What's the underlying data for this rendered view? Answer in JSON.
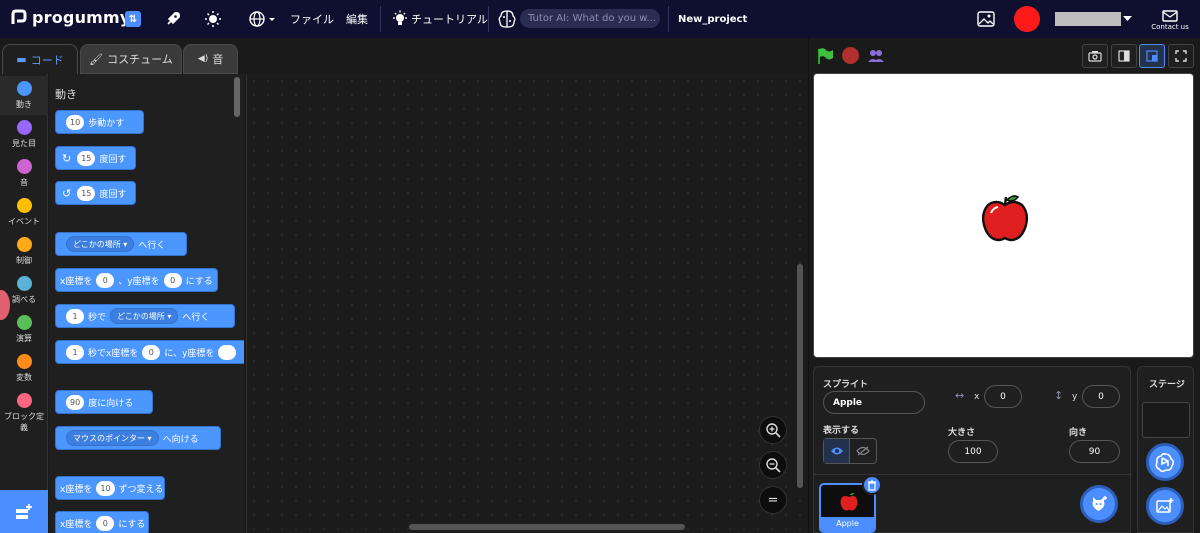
{
  "menubar": {
    "logo_text": "progummy",
    "file_label": "ファイル",
    "edit_label": "編集",
    "tutorial_label": "チュートリアル",
    "tutor_placeholder": "Tutor AI: What do you w...",
    "project_title": "New_project",
    "contact_label": "Contact us",
    "username_masked": ""
  },
  "tabs": {
    "code": "コード",
    "costume": "コスチューム",
    "sound": "音"
  },
  "categories": [
    {
      "label": "動き",
      "color": "#4c97ff"
    },
    {
      "label": "見た目",
      "color": "#9966ff"
    },
    {
      "label": "音",
      "color": "#cf63cf"
    },
    {
      "label": "イベント",
      "color": "#ffbf00"
    },
    {
      "label": "制御",
      "color": "#ffab19"
    },
    {
      "label": "調べる",
      "color": "#5cb1d6"
    },
    {
      "label": "演算",
      "color": "#59c059"
    },
    {
      "label": "変数",
      "color": "#ff8c1a"
    },
    {
      "label": "ブロック定",
      "label2": "義",
      "color": "#ff6680"
    }
  ],
  "palette": {
    "title": "動き",
    "move_steps": {
      "value": "10",
      "text": "歩動かす"
    },
    "turn_right": {
      "value": "15",
      "text": "度回す"
    },
    "turn_left": {
      "value": "15",
      "text": "度回す"
    },
    "goto": {
      "dropdown": "どこかの場所",
      "text": "へ行く"
    },
    "goto_xy": {
      "x_prefix": "x座標を",
      "x": "0",
      "y_prefix": "、y座標を",
      "y": "0",
      "suffix": "にする"
    },
    "glide_to": {
      "secs": "1",
      "mid": "秒で",
      "dropdown": "どこかの場所",
      "text": "へ行く"
    },
    "glide_xy": {
      "secs": "1",
      "mid": "秒でx座標を",
      "x": "0",
      "y_prefix": "に、y座標を"
    },
    "point_dir": {
      "value": "90",
      "text": "度に向ける"
    },
    "point_towards": {
      "dropdown": "マウスのポインター",
      "text": "へ向ける"
    },
    "change_x": {
      "prefix": "x座標を",
      "value": "10",
      "text": "ずつ変える"
    },
    "set_x": {
      "prefix": "x座標を",
      "value": "0",
      "text": "にする"
    }
  },
  "zoom": {
    "reset_label": "="
  },
  "sprite_info": {
    "header": "スプライト",
    "name": "Apple",
    "x_label": "x",
    "x": "0",
    "y_label": "y",
    "y": "0",
    "show_label": "表示する",
    "size_label": "大きさ",
    "size": "100",
    "direction_label": "向き",
    "direction": "90"
  },
  "sprites": [
    {
      "name": "Apple",
      "selected": true
    }
  ],
  "stage_panel": {
    "header": "ステージ"
  },
  "colors": {
    "menubar_bg": "#0f1030",
    "accent": "#4c8dff",
    "motion_block": "#4c97ff",
    "apple_red": "#e02020",
    "avatar": "#ff1a1a"
  }
}
